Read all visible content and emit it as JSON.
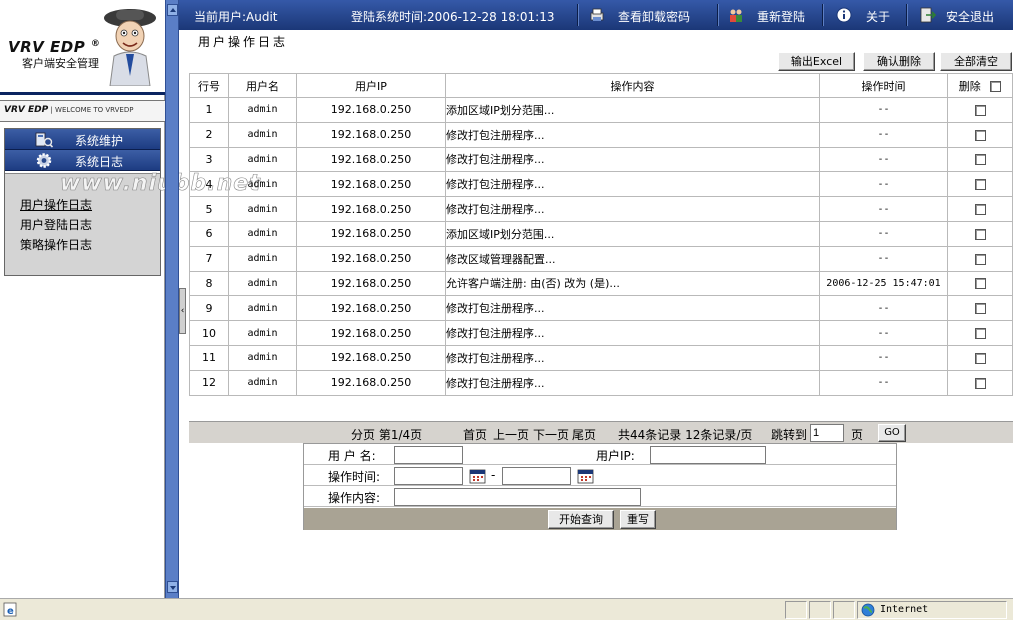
{
  "topbar": {
    "current_user": "当前用户:Audit",
    "login_time": "登陆系统时间:2006-12-28 18:01:13",
    "view_uninstall_password": "查看卸载密码",
    "relogin": "重新登陆",
    "about": "关于",
    "logout": "安全退出"
  },
  "logo": {
    "brand": "VRV EDP",
    "registered": "®",
    "subtitle": "客户端安全管理",
    "welcome_brand": "VRV EDP",
    "welcome_text": "| WELCOME TO VRVEDP"
  },
  "sidebar": {
    "sections": [
      {
        "label": "系统维护",
        "icon": "maintenance-icon"
      },
      {
        "label": "系统日志",
        "icon": "gear-icon"
      }
    ],
    "items": [
      {
        "label": "用户操作日志",
        "active": true
      },
      {
        "label": "用户登陆日志",
        "active": false
      },
      {
        "label": "策略操作日志",
        "active": false
      }
    ]
  },
  "watermark": "www.niubb.net",
  "main": {
    "title": "用户操作日志",
    "buttons": {
      "export_excel": "输出Excel",
      "confirm_delete": "确认删除",
      "clear_all": "全部清空"
    },
    "table": {
      "headers": {
        "row_no": "行号",
        "username": "用户名",
        "user_ip": "用户IP",
        "operation": "操作内容",
        "op_time": "操作时间",
        "delete": "删除"
      },
      "rows": [
        {
          "no": "1",
          "user": "admin",
          "ip": "192.168.0.250",
          "op": "添加区域IP划分范围...",
          "time": "--"
        },
        {
          "no": "2",
          "user": "admin",
          "ip": "192.168.0.250",
          "op": "修改打包注册程序...",
          "time": "--"
        },
        {
          "no": "3",
          "user": "admin",
          "ip": "192.168.0.250",
          "op": "修改打包注册程序...",
          "time": "--"
        },
        {
          "no": "4",
          "user": "admin",
          "ip": "192.168.0.250",
          "op": "修改打包注册程序...",
          "time": "--"
        },
        {
          "no": "5",
          "user": "admin",
          "ip": "192.168.0.250",
          "op": "修改打包注册程序...",
          "time": "--"
        },
        {
          "no": "6",
          "user": "admin",
          "ip": "192.168.0.250",
          "op": "添加区域IP划分范围...",
          "time": "--"
        },
        {
          "no": "7",
          "user": "admin",
          "ip": "192.168.0.250",
          "op": "修改区域管理器配置...",
          "time": "--"
        },
        {
          "no": "8",
          "user": "admin",
          "ip": "192.168.0.250",
          "op": "允许客户端注册: 由(否) 改为 (是)...",
          "time": "2006-12-25 15:47:01"
        },
        {
          "no": "9",
          "user": "admin",
          "ip": "192.168.0.250",
          "op": "修改打包注册程序...",
          "time": "--"
        },
        {
          "no": "10",
          "user": "admin",
          "ip": "192.168.0.250",
          "op": "修改打包注册程序...",
          "time": "--"
        },
        {
          "no": "11",
          "user": "admin",
          "ip": "192.168.0.250",
          "op": "修改打包注册程序...",
          "time": "--"
        },
        {
          "no": "12",
          "user": "admin",
          "ip": "192.168.0.250",
          "op": "修改打包注册程序...",
          "time": "--"
        }
      ]
    },
    "pager": {
      "page_info": "分页 第1/4页",
      "first": "首页",
      "prev": "上一页",
      "next": "下一页",
      "last": "尾页",
      "summary": "共44条记录 12条记录/页",
      "jump_label": "跳转到",
      "jump_value": "1",
      "page_unit": "页",
      "go": "GO"
    },
    "search": {
      "username_label": "用 户 名:",
      "user_ip_label": "用户IP:",
      "op_time_label": "操作时间:",
      "range_sep": "-",
      "op_content_label": "操作内容:",
      "start_query": "开始查询",
      "reset": "重写"
    }
  },
  "statusbar": {
    "zone": "Internet"
  },
  "colors": {
    "topbar": "#1b3777",
    "splitter": "#5a7ec6",
    "pager_bg": "#d6d3ce",
    "search_footer": "#a9a394"
  }
}
